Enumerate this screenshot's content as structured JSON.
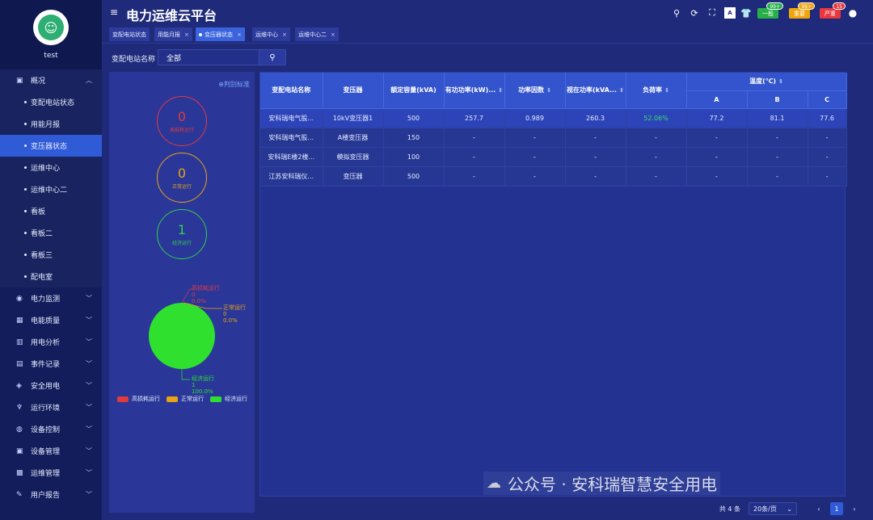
{
  "sidebar": {
    "username": "test",
    "menu_overview": "概况",
    "submenu": [
      "变配电站状态",
      "用能月报",
      "变压器状态",
      "运维中心",
      "运维中心二",
      "看板",
      "看板二",
      "看板三",
      "配电室"
    ],
    "groups": [
      "电力监测",
      "电能质量",
      "用电分析",
      "事件记录",
      "安全用电",
      "运行环境",
      "设备控制",
      "设备管理",
      "运维管理",
      "用户报告"
    ]
  },
  "header": {
    "title": "电力运维云平台",
    "alerts": [
      {
        "label": "一般",
        "count": "99+",
        "color": "#27b04a"
      },
      {
        "label": "重要",
        "count": "99+",
        "color": "#f0a50c"
      },
      {
        "label": "严重",
        "count": "15",
        "color": "#e8373d"
      }
    ]
  },
  "tabs": [
    "变配电站状态",
    "用能月报",
    "变压器状态",
    "运维中心",
    "运维中心二"
  ],
  "filter": {
    "label": "变配电站名称",
    "value": "全部"
  },
  "left_panel": {
    "criteria_link": "判别标准",
    "stats": [
      {
        "value": "0",
        "label": "高损耗运行",
        "color": "#e0393e"
      },
      {
        "value": "0",
        "label": "正常运行",
        "color": "#e8a317"
      },
      {
        "value": "1",
        "label": "经济运行",
        "color": "#2fcf4a"
      }
    ],
    "pie_labels": [
      {
        "name": "高损耗运行",
        "value": "0",
        "percent": "0.0%"
      },
      {
        "name": "正常运行",
        "value": "0",
        "percent": "0.0%"
      },
      {
        "name": "经济运行",
        "value": "1",
        "percent": "100.0%"
      }
    ],
    "legend": [
      "高损耗运行",
      "正常运行",
      "经济运行"
    ]
  },
  "table": {
    "headers": [
      "变配电站名称",
      "变压器",
      "额定容量(kVA)",
      "有功功率(kW)...",
      "功率因数",
      "视在功率(kVA...",
      "负荷率",
      "温度(℃)"
    ],
    "temp_sub": [
      "A",
      "B",
      "C"
    ],
    "rows": [
      [
        "安科瑞电气股...",
        "10kV变压器1",
        "500",
        "257.7",
        "0.989",
        "260.3",
        "52.06%",
        "77.2",
        "81.1",
        "77.6"
      ],
      [
        "安科瑞电气股...",
        "A楼变压器",
        "150",
        "-",
        "-",
        "-",
        "-",
        "-",
        "-",
        "-"
      ],
      [
        "安科瑞E楼2楼...",
        "模拟变压器",
        "100",
        "-",
        "-",
        "-",
        "-",
        "-",
        "-",
        "-"
      ],
      [
        "江苏安科瑞仪...",
        "变压器",
        "500",
        "-",
        "-",
        "-",
        "-",
        "-",
        "-",
        "-"
      ]
    ]
  },
  "pagination": {
    "total": "共 4 条",
    "page_size": "20条/页",
    "current_page": "1"
  },
  "watermark": "公众号 · 安科瑞智慧安全用电"
}
